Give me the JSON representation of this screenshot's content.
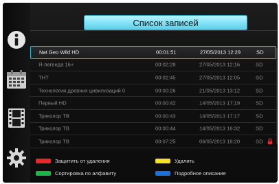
{
  "header": {
    "title": "Список записей"
  },
  "sidebar": {
    "items": [
      {
        "icon": "info-icon"
      },
      {
        "icon": "calendar-icon"
      },
      {
        "icon": "film-icon"
      },
      {
        "icon": "gear-icon"
      }
    ]
  },
  "recordings": [
    {
      "name": "Nat Geo Wild HD",
      "duration": "00:01:51",
      "date": "27/05/2013 12:29",
      "quality": "SD",
      "locked": false,
      "selected": true
    },
    {
      "name": "Я-легенда 16+",
      "duration": "00:02:28",
      "date": "27/05/2013 12:16",
      "quality": "SD",
      "locked": false
    },
    {
      "name": "ТНТ",
      "duration": "00:02:45",
      "date": "27/05/2013 12:05",
      "quality": "SD",
      "locked": false
    },
    {
      "name": "Технологии древних цивилизаций 0",
      "duration": "00:00:26",
      "date": "21/05/2013 13:12",
      "quality": "SD",
      "locked": false
    },
    {
      "name": "Первый HD",
      "duration": "00:00:42",
      "date": "14/05/2013 17:19",
      "quality": "SD",
      "locked": false
    },
    {
      "name": "Триколор ТВ",
      "duration": "00:00:43",
      "date": "14/05/2013 17:17",
      "quality": "SD",
      "locked": false
    },
    {
      "name": "Триколор ТВ",
      "duration": "00:00:44",
      "date": "14/05/2013 16:32",
      "quality": "SD",
      "locked": false
    },
    {
      "name": "Триколор ТВ",
      "duration": "00:07:25",
      "date": "06/05/2013 18:20",
      "quality": "SD",
      "locked": true
    }
  ],
  "legend": {
    "red": {
      "label": "Защитить от удаления",
      "color": "#e8262b"
    },
    "yellow": {
      "label": "Удалить",
      "color": "#f3e22a"
    },
    "green": {
      "label": "Сортировка по алфавиту",
      "color": "#1db54a"
    },
    "blue": {
      "label": "Подробное описание",
      "color": "#1e6fd6"
    }
  },
  "colors": {
    "accent": "#7fe2f6",
    "lock": "#e8262b"
  }
}
